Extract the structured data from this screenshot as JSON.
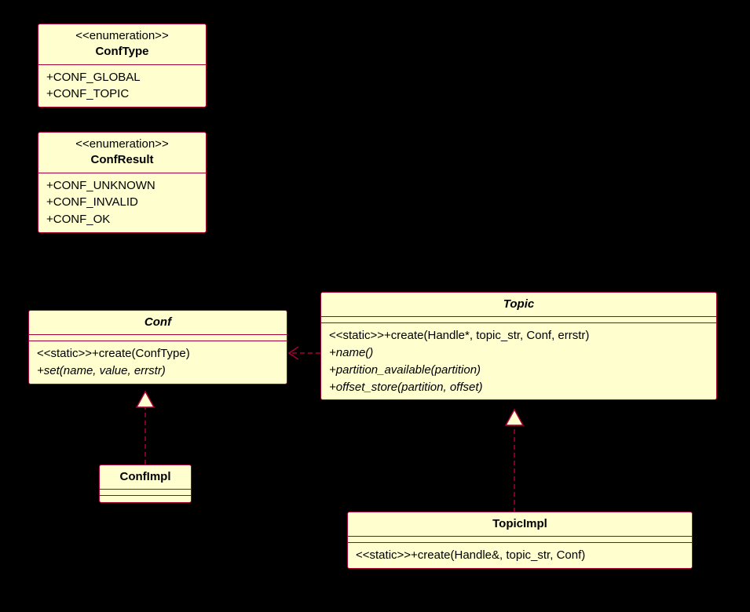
{
  "enums": {
    "confType": {
      "stereotype": "<<enumeration>>",
      "name": "ConfType",
      "values": [
        "+CONF_GLOBAL",
        "+CONF_TOPIC"
      ]
    },
    "confResult": {
      "stereotype": "<<enumeration>>",
      "name": "ConfResult",
      "values": [
        "+CONF_UNKNOWN",
        "+CONF_INVALID",
        "+CONF_OK"
      ]
    }
  },
  "classes": {
    "conf": {
      "name": "Conf",
      "methods": {
        "m0": "<<static>>+create(ConfType)",
        "m1": "+set(name, value, errstr)"
      }
    },
    "confImpl": {
      "name": "ConfImpl"
    },
    "topic": {
      "name": "Topic",
      "methods": {
        "m0": "<<static>>+create(Handle*, topic_str, Conf, errstr)",
        "m1": "+name()",
        "m2": "+partition_available(partition)",
        "m3": "+offset_store(partition, offset)"
      }
    },
    "topicImpl": {
      "name": "TopicImpl",
      "methods": {
        "m0": "<<static>>+create(Handle&, topic_str, Conf)"
      }
    }
  }
}
